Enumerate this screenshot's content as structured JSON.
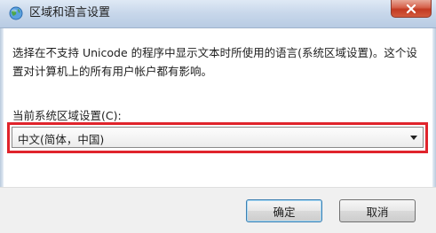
{
  "window": {
    "title": "区域和语言设置",
    "icon": "globe-icon",
    "close_icon": "close-icon"
  },
  "description": "选择在不支持 Unicode 的程序中显示文本时所使用的语言(系统区域设置)。这个设置对计算机上的所有用户帐户都有影响。",
  "locale": {
    "label": "当前系统区域设置(C):",
    "selected": "中文(简体，中国)"
  },
  "buttons": {
    "ok": "确定",
    "cancel": "取消"
  },
  "colors": {
    "highlight": "#e0242c",
    "ok_border": "#3c7fb1"
  }
}
